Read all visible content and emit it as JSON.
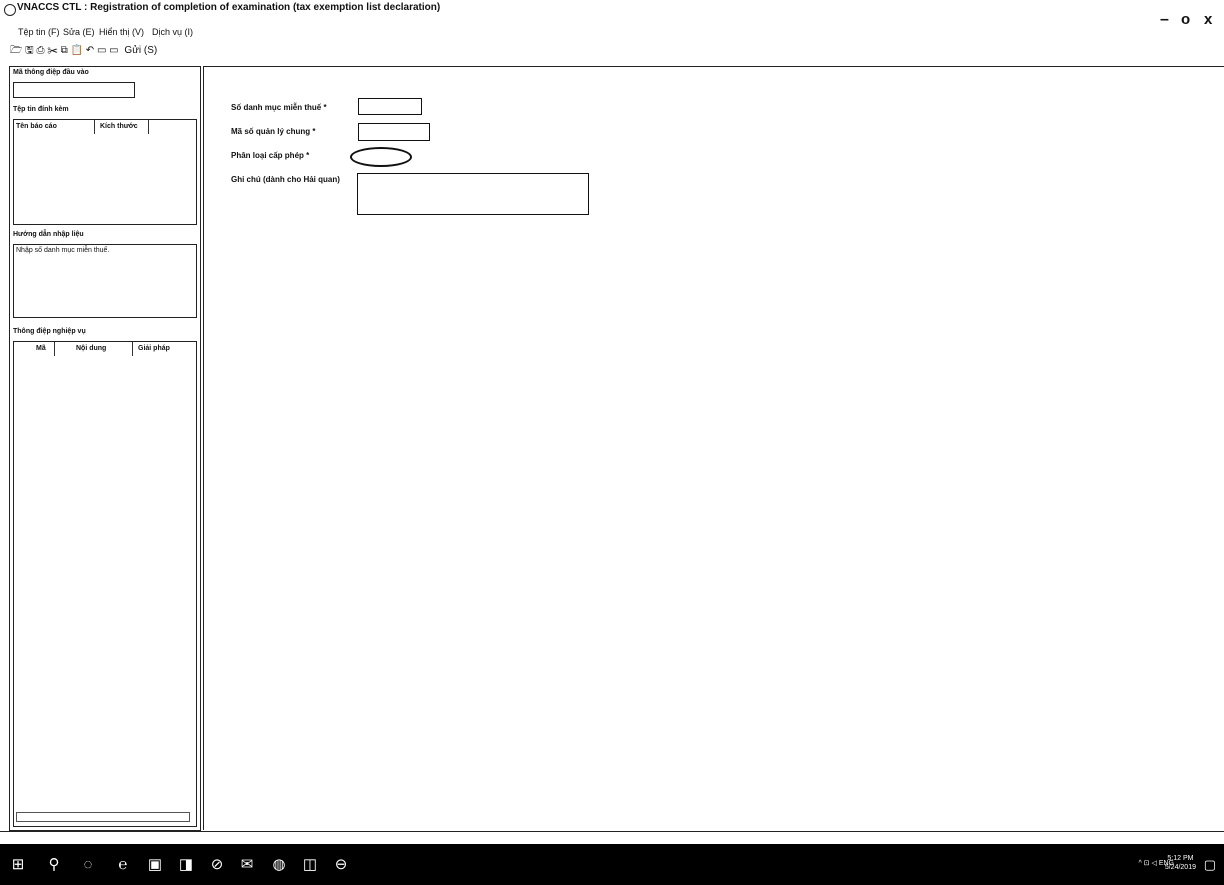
{
  "window": {
    "title": "VNACCS CTL : Registration of completion of examination (tax exemption list declaration)",
    "minimize": "–",
    "maximize": "o",
    "close": "x"
  },
  "menu": [
    "Tệp tin (F)",
    "Sửa (E)",
    "Hiển thị (V)",
    "Dịch vụ (I)"
  ],
  "toolbar": {
    "icons": [
      "open-icon",
      "save-icon",
      "print-icon",
      "cut-icon",
      "copy-icon",
      "paste-icon",
      "undo-icon",
      "send-icon",
      "window-icon"
    ],
    "glyphs": "🗁 🖫 ⎙ ✂ ⧉ 📋 ↶ ▭ ▭",
    "send_label": "Gửi (S)"
  },
  "left_panel": {
    "message_code_title": "Mã thông điệp đầu vào",
    "attached_files_title": "Tệp tin đính kèm",
    "attached_columns": [
      "Tên báo cáo",
      "Kích thước"
    ],
    "input_guide_title": "Hướng dẫn nhập liệu",
    "input_guide_text": "Nhập số danh mục miễn thuế.",
    "business_messages_title": "Thông điệp nghiệp vụ",
    "business_columns": [
      "Mã",
      "Nội dung",
      "Giải pháp"
    ]
  },
  "form": {
    "exemption_list_no_label": "Số danh mục miễn thuế *",
    "general_management_no_label": "Mã số quản lý chung *",
    "permit_type_label": "Phân loại cấp phép *",
    "notes_label": "Ghi chú (dành cho Hải quan)"
  },
  "taskbar": {
    "tray_text": "^ ⊡ ◁ ENG",
    "clock_time": "5:12 PM",
    "clock_date": "5/24/2019"
  }
}
